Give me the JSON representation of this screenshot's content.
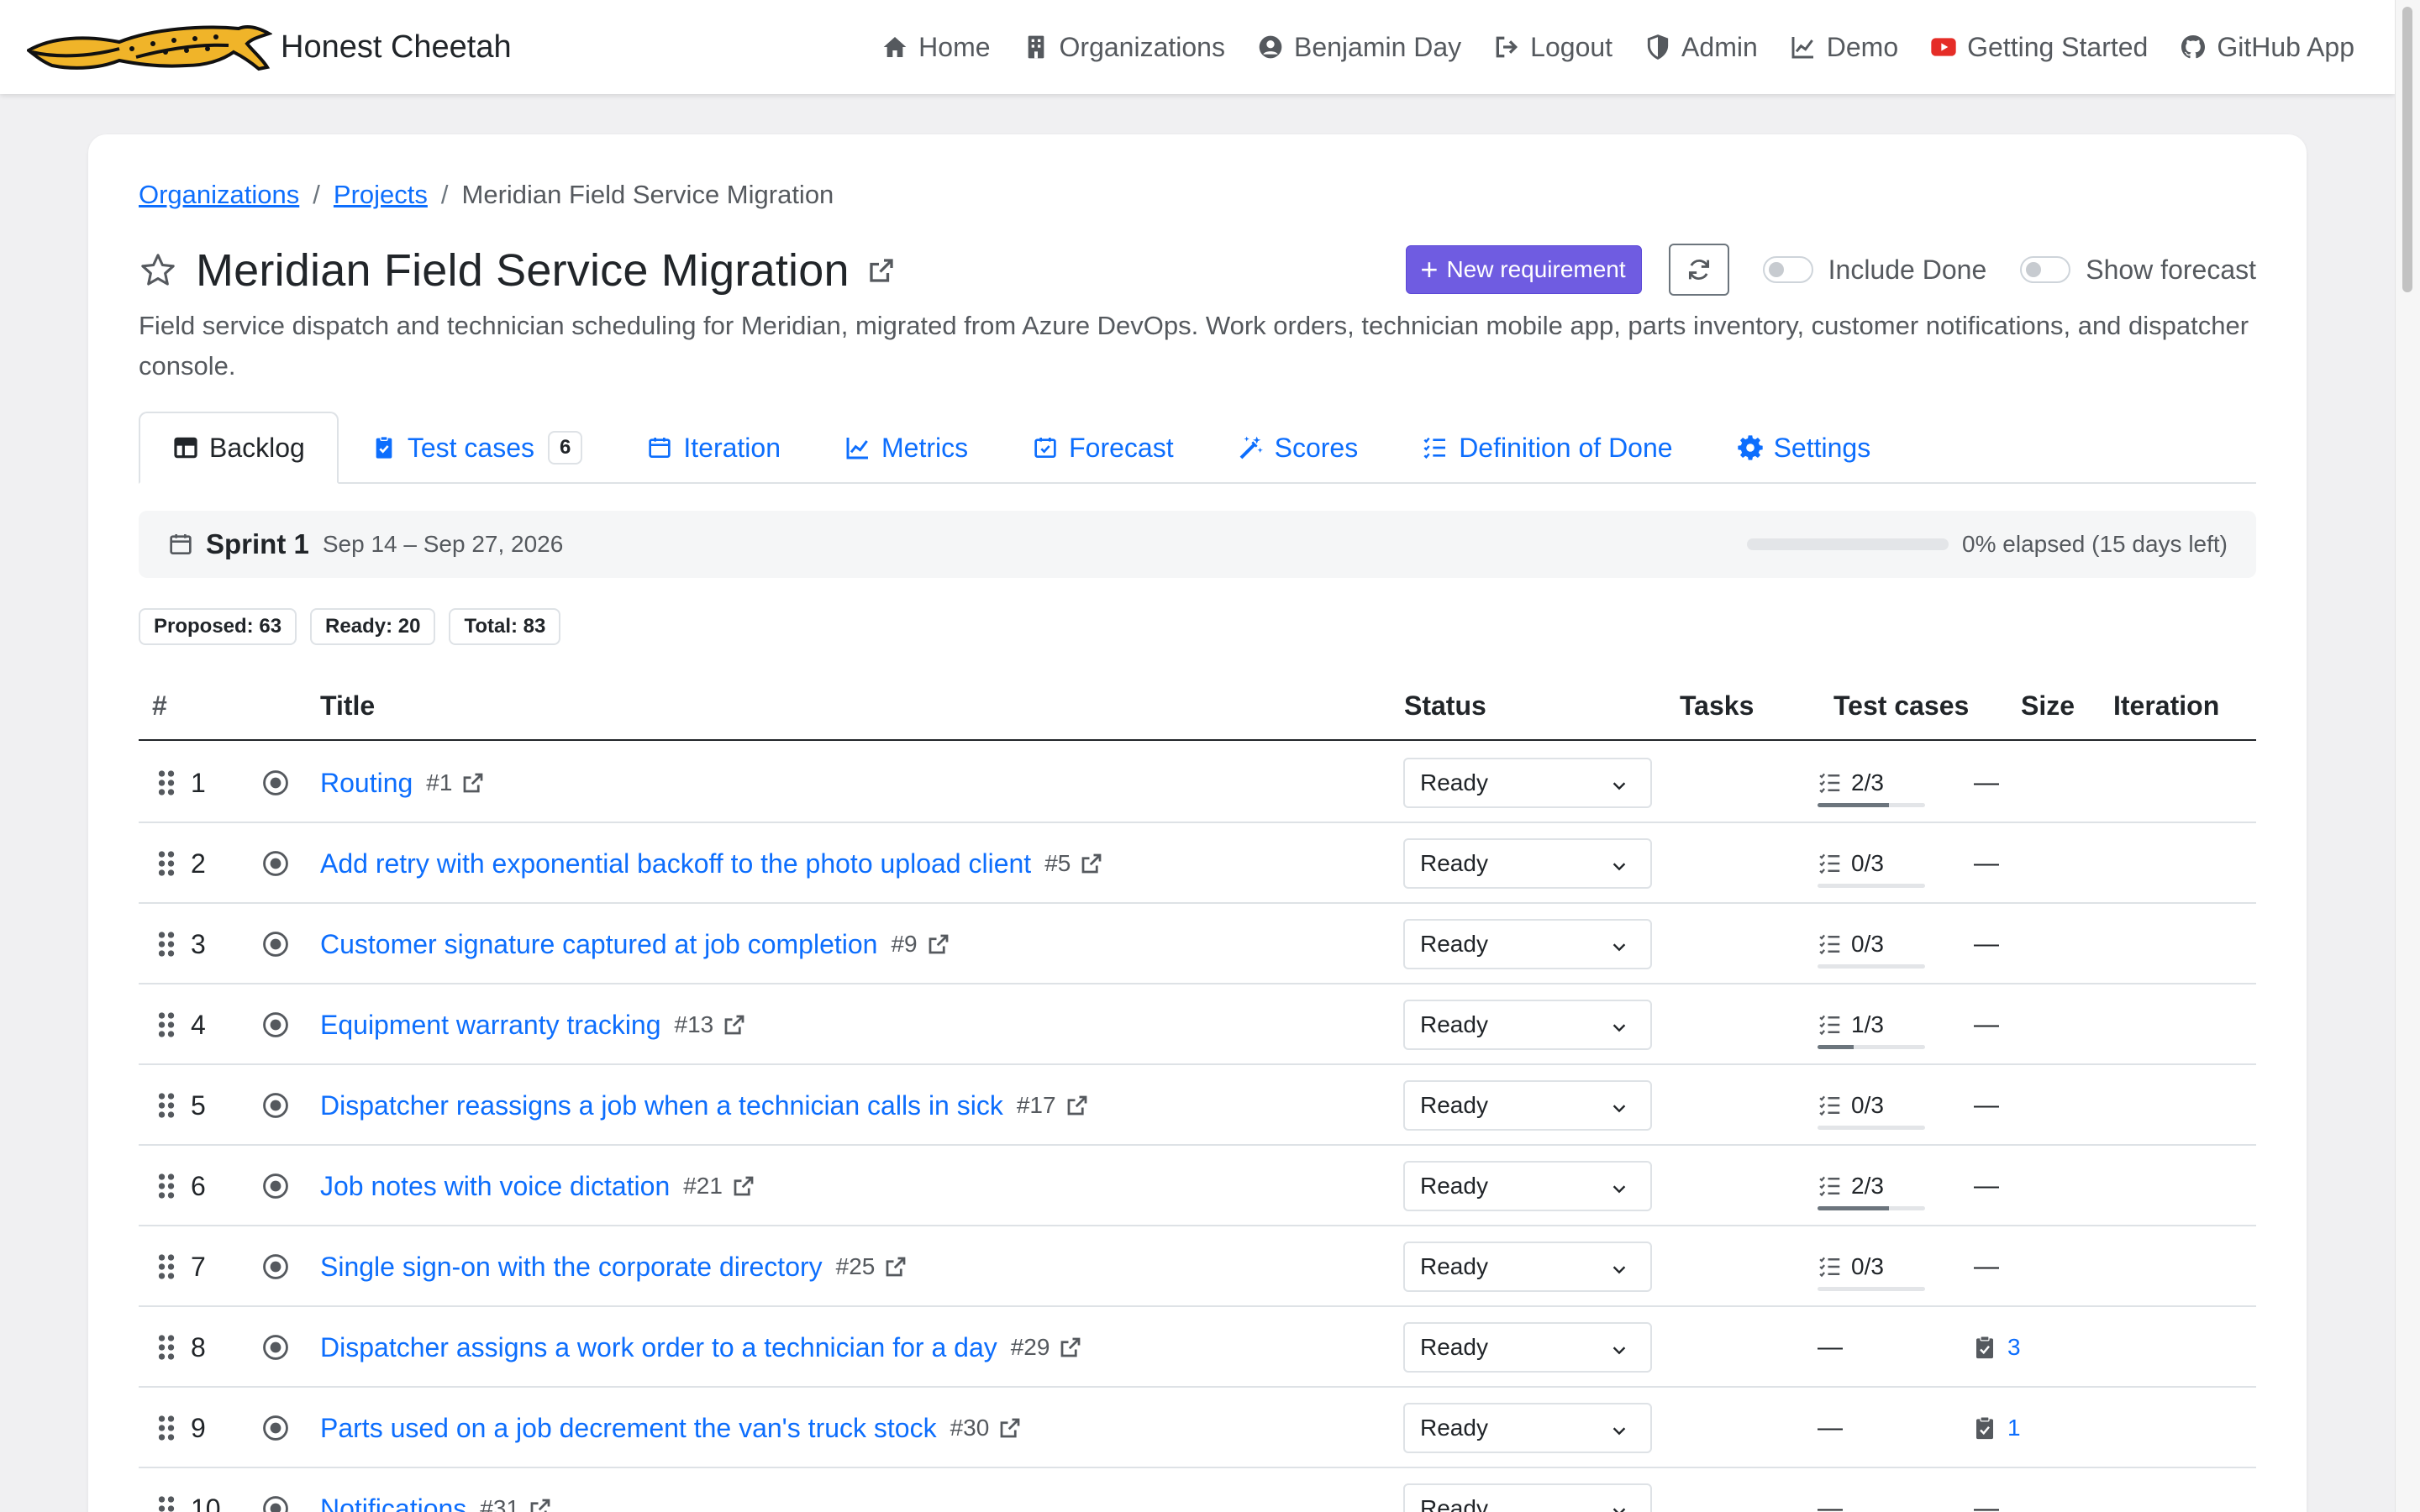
{
  "brand": {
    "name": "Honest Cheetah"
  },
  "nav": [
    {
      "label": "Home",
      "icon": "home-icon"
    },
    {
      "label": "Organizations",
      "icon": "building-icon"
    },
    {
      "label": "Benjamin Day",
      "icon": "user-circle-icon"
    },
    {
      "label": "Logout",
      "icon": "logout-icon"
    },
    {
      "label": "Admin",
      "icon": "shield-icon"
    },
    {
      "label": "Demo",
      "icon": "chart-line-icon"
    },
    {
      "label": "Getting Started",
      "icon": "youtube-icon"
    },
    {
      "label": "GitHub App",
      "icon": "github-icon"
    }
  ],
  "breadcrumb": {
    "organizations": "Organizations",
    "projects": "Projects",
    "current": "Meridian Field Service Migration"
  },
  "project": {
    "title": "Meridian Field Service Migration",
    "description": "Field service dispatch and technician scheduling for Meridian, migrated from Azure DevOps. Work orders, technician mobile app, parts inventory, customer notifications, and dispatcher console."
  },
  "actions": {
    "new_requirement": "New requirement",
    "include_done": "Include Done",
    "show_forecast": "Show forecast"
  },
  "tabs": [
    {
      "label": "Backlog",
      "icon": "kanban-icon",
      "active": true
    },
    {
      "label": "Test cases",
      "icon": "clipboard-check-icon",
      "badge": "6"
    },
    {
      "label": "Iteration",
      "icon": "calendar-icon"
    },
    {
      "label": "Metrics",
      "icon": "chart-line-icon"
    },
    {
      "label": "Forecast",
      "icon": "calendar-check-icon"
    },
    {
      "label": "Scores",
      "icon": "magic-wand-icon"
    },
    {
      "label": "Definition of Done",
      "icon": "list-check-icon"
    },
    {
      "label": "Settings",
      "icon": "gear-icon"
    }
  ],
  "sprint": {
    "name": "Sprint 1",
    "dates": "Sep 14 – Sep 27, 2026",
    "elapsed_label": "0% elapsed (15 days left)",
    "elapsed_fraction": 0
  },
  "counts": {
    "proposed": "Proposed: 63",
    "ready": "Ready: 20",
    "total": "Total: 83"
  },
  "table": {
    "headers": {
      "num": "#",
      "title": "Title",
      "status": "Status",
      "tasks": "Tasks",
      "test_cases": "Test cases",
      "size": "Size",
      "iteration": "Iteration"
    },
    "rows": [
      {
        "num": "1",
        "title": "Routing",
        "id": "#1",
        "status": "Ready",
        "tasks": "2/3",
        "tasks_fraction": 0.667,
        "test_cases": "—"
      },
      {
        "num": "2",
        "title": "Add retry with exponential backoff to the photo upload client",
        "id": "#5",
        "status": "Ready",
        "tasks": "0/3",
        "tasks_fraction": 0,
        "test_cases": "—"
      },
      {
        "num": "3",
        "title": "Customer signature captured at job completion",
        "id": "#9",
        "status": "Ready",
        "tasks": "0/3",
        "tasks_fraction": 0,
        "test_cases": "—"
      },
      {
        "num": "4",
        "title": "Equipment warranty tracking",
        "id": "#13",
        "status": "Ready",
        "tasks": "1/3",
        "tasks_fraction": 0.333,
        "test_cases": "—"
      },
      {
        "num": "5",
        "title": "Dispatcher reassigns a job when a technician calls in sick",
        "id": "#17",
        "status": "Ready",
        "tasks": "0/3",
        "tasks_fraction": 0,
        "test_cases": "—"
      },
      {
        "num": "6",
        "title": "Job notes with voice dictation",
        "id": "#21",
        "status": "Ready",
        "tasks": "2/3",
        "tasks_fraction": 0.667,
        "test_cases": "—"
      },
      {
        "num": "7",
        "title": "Single sign-on with the corporate directory",
        "id": "#25",
        "status": "Ready",
        "tasks": "0/3",
        "tasks_fraction": 0,
        "test_cases": "—"
      },
      {
        "num": "8",
        "title": "Dispatcher assigns a work order to a technician for a day",
        "id": "#29",
        "status": "Ready",
        "tasks": "—",
        "test_cases": "3"
      },
      {
        "num": "9",
        "title": "Parts used on a job decrement the van's truck stock",
        "id": "#30",
        "status": "Ready",
        "tasks": "—",
        "test_cases": "1"
      },
      {
        "num": "10",
        "title": "Notifications",
        "id": "#31",
        "status": "Ready",
        "tasks": "—",
        "test_cases": "—"
      }
    ]
  },
  "colors": {
    "accent": "#6f5ce1",
    "link": "#0d6efd",
    "muted": "#55595e",
    "cheetah": "#f0b429"
  }
}
